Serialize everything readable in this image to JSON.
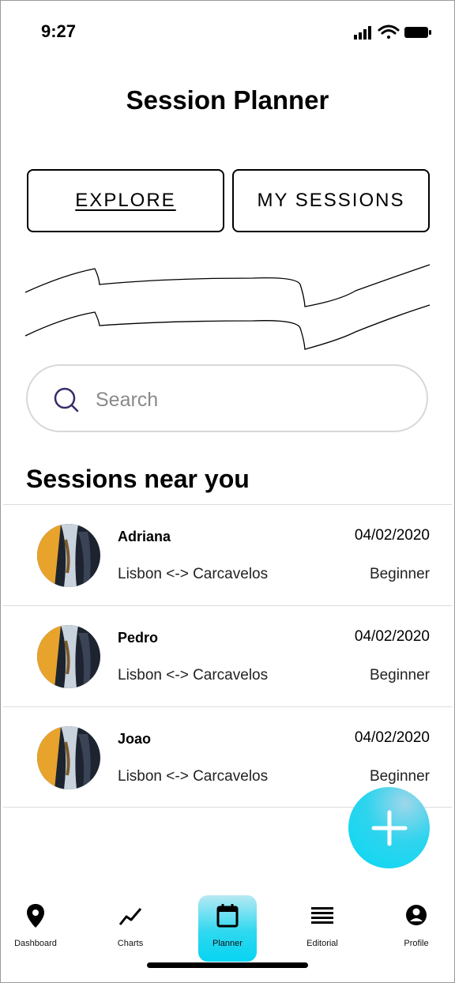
{
  "status_bar": {
    "time": "9:27"
  },
  "header": {
    "title": "Session Planner"
  },
  "tabs": [
    {
      "label": "EXPLORE",
      "active": true
    },
    {
      "label": "MY SESSIONS",
      "active": false
    }
  ],
  "search": {
    "placeholder": "Search"
  },
  "sessions_section": {
    "title": "Sessions near you",
    "rows": [
      {
        "name": "Adriana",
        "date": "04/02/2020",
        "route": "Lisbon <-> Carcavelos",
        "level": "Beginner"
      },
      {
        "name": "Pedro",
        "date": "04/02/2020",
        "route": "Lisbon <-> Carcavelos",
        "level": "Beginner"
      },
      {
        "name": "Joao",
        "date": "04/02/2020",
        "route": "Lisbon <-> Carcavelos",
        "level": "Beginner"
      }
    ]
  },
  "fab": {
    "icon": "plus-icon",
    "color": "#08d8f3"
  },
  "tab_bar": {
    "items": [
      {
        "label": "Dashboard",
        "icon": "location-pin-icon"
      },
      {
        "label": "Charts",
        "icon": "trend-line-icon"
      },
      {
        "label": "Planner",
        "icon": "calendar-icon",
        "active": true
      },
      {
        "label": "Editorial",
        "icon": "list-lines-icon"
      },
      {
        "label": "Profile",
        "icon": "user-circle-icon"
      }
    ]
  },
  "colors": {
    "accent": "#08d8f3",
    "text": "#000000",
    "muted": "#8a8a8a"
  }
}
